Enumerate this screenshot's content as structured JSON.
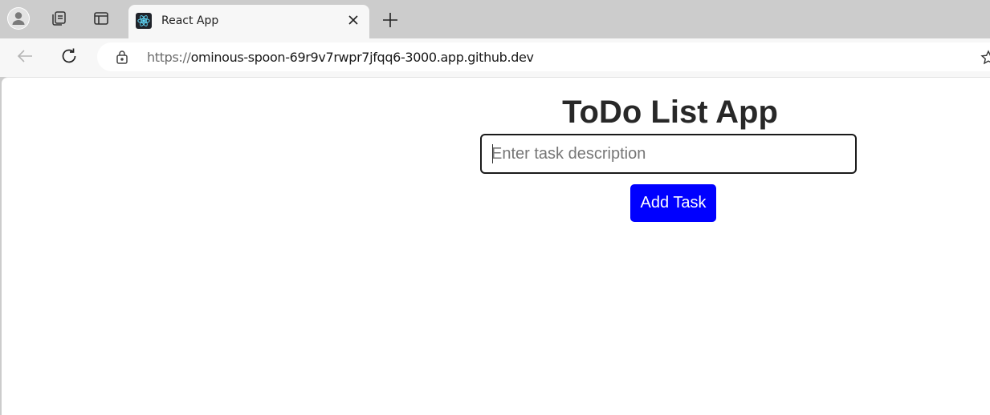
{
  "browser": {
    "tab": {
      "title": "React App"
    },
    "address_bar": {
      "scheme": "https://",
      "host": "ominous-spoon-69r9v7rwpr7jfqq6-3000.app.github.dev"
    }
  },
  "app": {
    "title": "ToDo List App",
    "task_input": {
      "placeholder": "Enter task description",
      "value": ""
    },
    "add_button_label": "Add Task"
  },
  "colors": {
    "add_button_bg": "#0000ff",
    "title_text": "#282828",
    "tabstrip_bg": "#cccccc"
  },
  "icons": {
    "profile": "profile-icon",
    "workspaces": "workspaces-icon",
    "tab_actions": "tab-actions-icon",
    "favicon": "react-logo-icon",
    "close": "close-icon",
    "new_tab": "plus-icon",
    "back": "back-arrow-icon",
    "reload": "reload-icon",
    "lock": "lock-icon",
    "favorite": "star-icon"
  }
}
